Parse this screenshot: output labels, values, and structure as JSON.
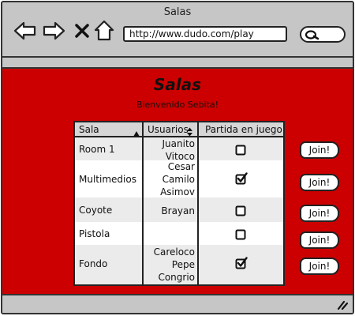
{
  "window": {
    "title": "Salas"
  },
  "browser": {
    "url": "http://www.dudo.com/play"
  },
  "page": {
    "title": "Salas",
    "welcome": "Bienvenido Sebita!"
  },
  "table": {
    "headers": {
      "room": "Sala",
      "users": "Usuarios",
      "game": "Partida en juego"
    },
    "rows": [
      {
        "room": "Room 1",
        "users": [
          "Juanito",
          "Vitoco"
        ],
        "in_game": false
      },
      {
        "room": "Multimedios",
        "users": [
          "Cesar",
          "Camilo",
          "Asimov"
        ],
        "in_game": true
      },
      {
        "room": "Coyote",
        "users": [
          "Brayan"
        ],
        "in_game": false
      },
      {
        "room": "Pistola",
        "users": [],
        "in_game": false
      },
      {
        "room": "Fondo",
        "users": [
          "Careloco",
          "Pepe",
          "Congrio"
        ],
        "in_game": true
      }
    ]
  },
  "join_label": "Join!",
  "icons": {
    "back": "arrow-left-icon",
    "forward": "arrow-right-icon",
    "stop": "close-icon",
    "home": "home-icon",
    "search": "search-icon",
    "sort_asc": "sort-up-icon",
    "sort_both": "sort-updown-icon",
    "resize": "resize-grip-icon"
  },
  "colors": {
    "content_bg": "#cc0000",
    "chrome": "#c6c6c6",
    "header_row": "#d6d6d6",
    "alt_row": "#ebebeb"
  }
}
